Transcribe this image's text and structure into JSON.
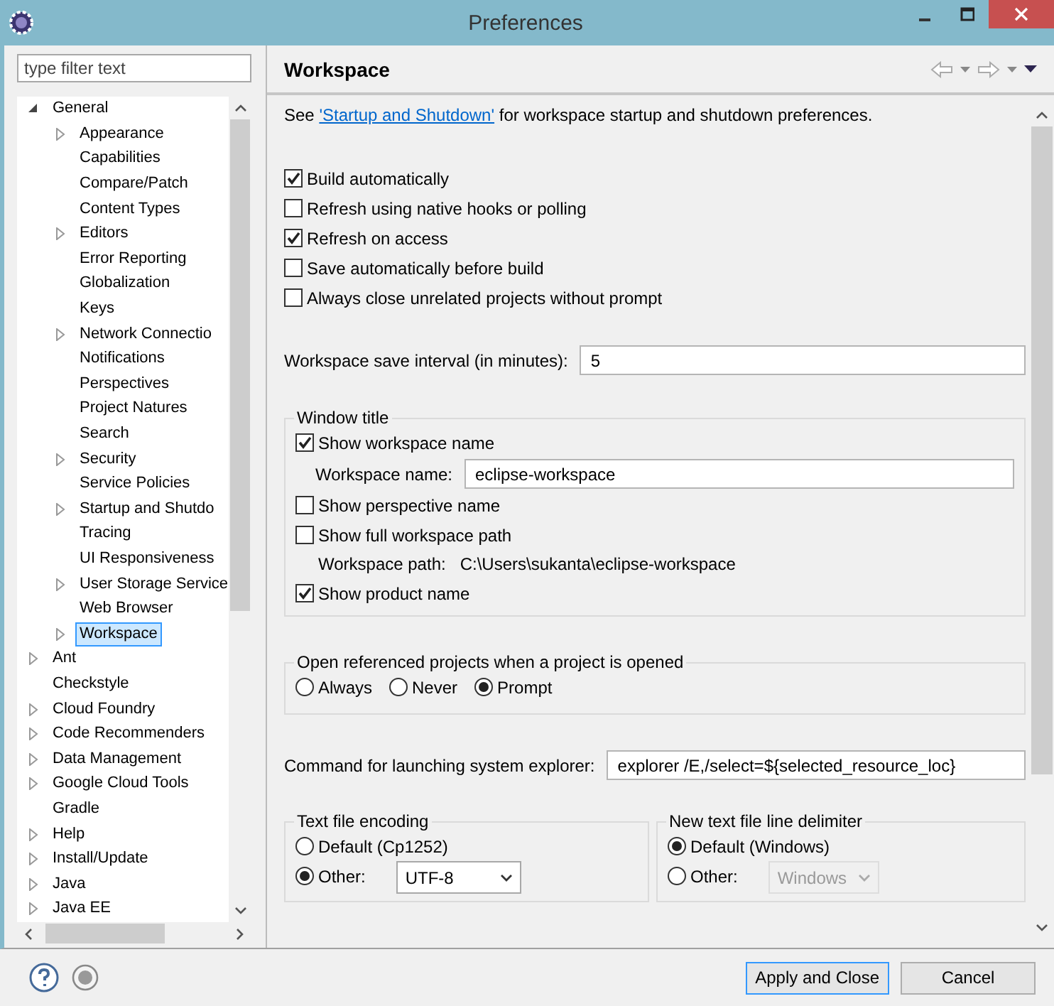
{
  "window": {
    "title": "Preferences"
  },
  "filter": {
    "placeholder": "type filter text"
  },
  "tree": [
    {
      "label": "General",
      "expandable": true,
      "expanded": true,
      "selected": false,
      "children": [
        {
          "label": "Appearance",
          "expandable": true,
          "expanded": false,
          "selected": false
        },
        {
          "label": "Capabilities",
          "expandable": false,
          "expanded": false,
          "selected": false
        },
        {
          "label": "Compare/Patch",
          "expandable": false,
          "expanded": false,
          "selected": false
        },
        {
          "label": "Content Types",
          "expandable": false,
          "expanded": false,
          "selected": false
        },
        {
          "label": "Editors",
          "expandable": true,
          "expanded": false,
          "selected": false
        },
        {
          "label": "Error Reporting",
          "expandable": false,
          "expanded": false,
          "selected": false
        },
        {
          "label": "Globalization",
          "expandable": false,
          "expanded": false,
          "selected": false
        },
        {
          "label": "Keys",
          "expandable": false,
          "expanded": false,
          "selected": false
        },
        {
          "label": "Network Connectio",
          "expandable": true,
          "expanded": false,
          "selected": false
        },
        {
          "label": "Notifications",
          "expandable": false,
          "expanded": false,
          "selected": false
        },
        {
          "label": "Perspectives",
          "expandable": false,
          "expanded": false,
          "selected": false
        },
        {
          "label": "Project Natures",
          "expandable": false,
          "expanded": false,
          "selected": false
        },
        {
          "label": "Search",
          "expandable": false,
          "expanded": false,
          "selected": false
        },
        {
          "label": "Security",
          "expandable": true,
          "expanded": false,
          "selected": false
        },
        {
          "label": "Service Policies",
          "expandable": false,
          "expanded": false,
          "selected": false
        },
        {
          "label": "Startup and Shutdo",
          "expandable": true,
          "expanded": false,
          "selected": false
        },
        {
          "label": "Tracing",
          "expandable": false,
          "expanded": false,
          "selected": false
        },
        {
          "label": "UI Responsiveness",
          "expandable": false,
          "expanded": false,
          "selected": false
        },
        {
          "label": "User Storage Service",
          "expandable": true,
          "expanded": false,
          "selected": false
        },
        {
          "label": "Web Browser",
          "expandable": false,
          "expanded": false,
          "selected": false
        },
        {
          "label": "Workspace",
          "expandable": true,
          "expanded": false,
          "selected": true
        }
      ]
    },
    {
      "label": "Ant",
      "expandable": true,
      "expanded": false,
      "selected": false
    },
    {
      "label": "Checkstyle",
      "expandable": false,
      "expanded": false,
      "selected": false
    },
    {
      "label": "Cloud Foundry",
      "expandable": true,
      "expanded": false,
      "selected": false
    },
    {
      "label": "Code Recommenders",
      "expandable": true,
      "expanded": false,
      "selected": false
    },
    {
      "label": "Data Management",
      "expandable": true,
      "expanded": false,
      "selected": false
    },
    {
      "label": "Google Cloud Tools",
      "expandable": true,
      "expanded": false,
      "selected": false
    },
    {
      "label": "Gradle",
      "expandable": false,
      "expanded": false,
      "selected": false
    },
    {
      "label": "Help",
      "expandable": true,
      "expanded": false,
      "selected": false
    },
    {
      "label": "Install/Update",
      "expandable": true,
      "expanded": false,
      "selected": false
    },
    {
      "label": "Java",
      "expandable": true,
      "expanded": false,
      "selected": false
    },
    {
      "label": "Java EE",
      "expandable": true,
      "expanded": false,
      "selected": false
    }
  ],
  "page": {
    "title": "Workspace",
    "intro": {
      "before": "See ",
      "link": "'Startup and Shutdown'",
      "after": " for workspace startup and shutdown preferences."
    },
    "options": [
      {
        "label": "Build automatically",
        "checked": true
      },
      {
        "label": "Refresh using native hooks or polling",
        "checked": false
      },
      {
        "label": "Refresh on access",
        "checked": true
      },
      {
        "label": "Save automatically before build",
        "checked": false
      },
      {
        "label": "Always close unrelated projects without prompt",
        "checked": false
      }
    ],
    "save_interval": {
      "label": "Workspace save interval (in minutes):",
      "value": "5"
    },
    "window_title": {
      "title": "Window title",
      "items": [
        {
          "kind": "checkbox",
          "label": "Show workspace name",
          "checked": true
        },
        {
          "kind": "field",
          "label": "Workspace name:",
          "value": "eclipse-workspace"
        },
        {
          "kind": "checkbox",
          "label": "Show perspective name",
          "checked": false
        },
        {
          "kind": "checkbox",
          "label": "Show full workspace path",
          "checked": false
        },
        {
          "kind": "path",
          "label": "Workspace path:",
          "value": "C:\\Users\\sukanta\\eclipse-workspace"
        },
        {
          "kind": "checkbox",
          "label": "Show product name",
          "checked": true
        }
      ]
    },
    "open_referenced": {
      "title": "Open referenced projects when a project is opened",
      "options": [
        {
          "label": "Always",
          "selected": false
        },
        {
          "label": "Never",
          "selected": false
        },
        {
          "label": "Prompt",
          "selected": true
        }
      ]
    },
    "explorer": {
      "label": "Command for launching system explorer:",
      "value": "explorer /E,/select=${selected_resource_loc}"
    },
    "encoding": {
      "title": "Text file encoding",
      "options": [
        {
          "kind": "radio",
          "label": "Default (Cp1252)",
          "selected": false
        },
        {
          "kind": "combo",
          "label": "Other:",
          "selected": true,
          "value": "UTF-8",
          "disabled": false
        }
      ]
    },
    "delimiter": {
      "title": "New text file line delimiter",
      "options": [
        {
          "kind": "radio",
          "label": "Default (Windows)",
          "selected": true
        },
        {
          "kind": "combo",
          "label": "Other:",
          "selected": false,
          "value": "Windows",
          "disabled": true
        }
      ]
    }
  },
  "buttons": [
    {
      "label": "Apply and Close",
      "default": true
    },
    {
      "label": "Cancel",
      "default": false
    }
  ]
}
